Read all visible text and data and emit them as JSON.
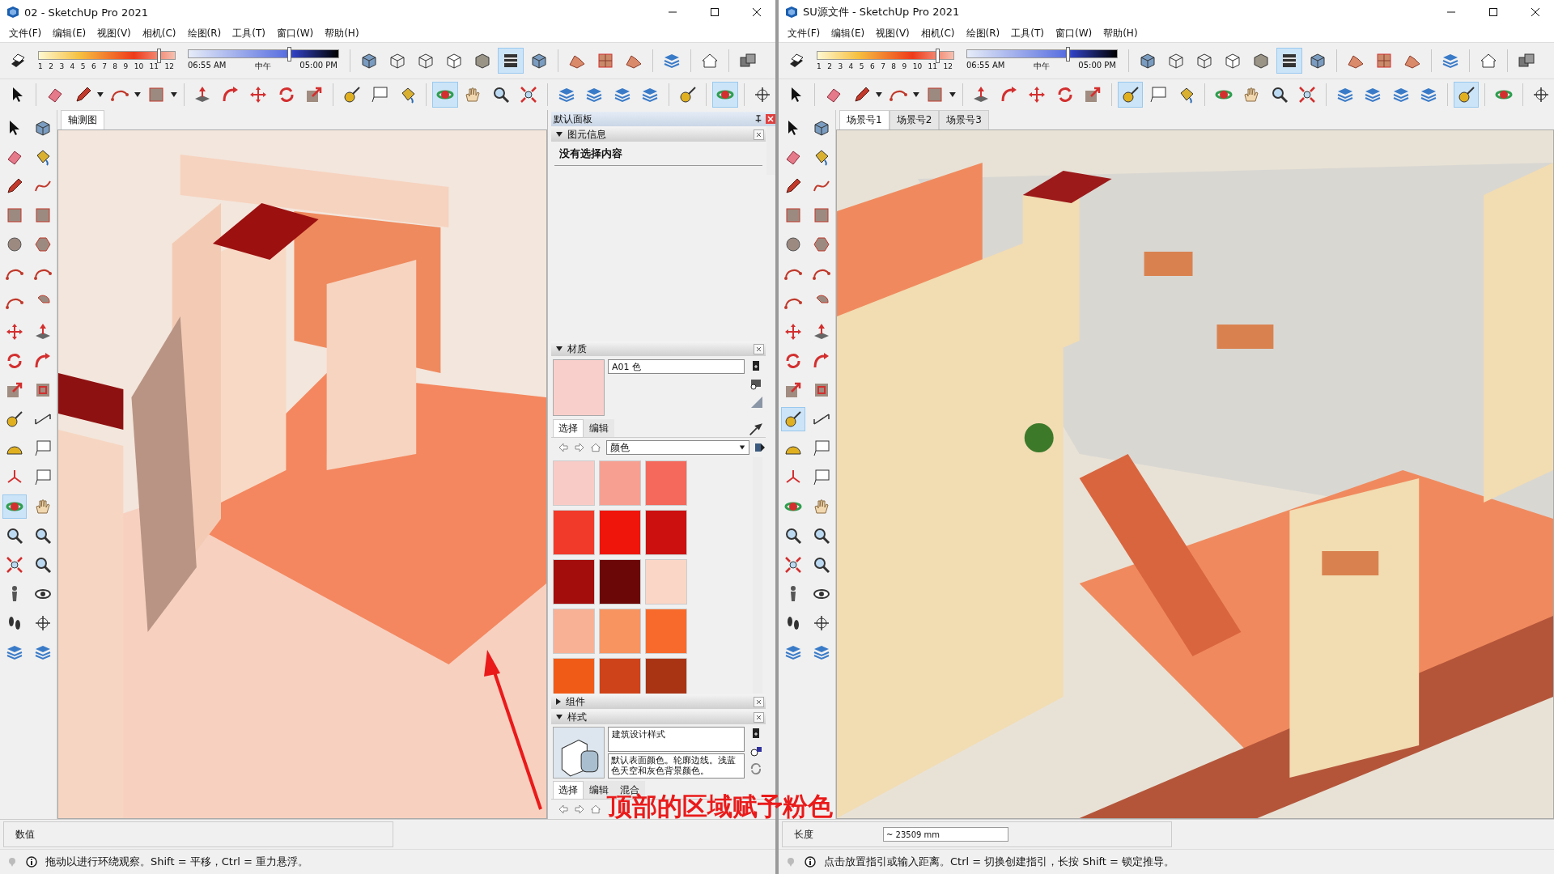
{
  "windows": [
    {
      "title": "02 - SketchUp Pro 2021",
      "menu": [
        "文件(F)",
        "编辑(E)",
        "视图(V)",
        "相机(C)",
        "绘图(R)",
        "工具(T)",
        "窗口(W)",
        "帮助(H)"
      ],
      "shadow_months": {
        "labels": [
          "1",
          "2",
          "3",
          "4",
          "5",
          "6",
          "7",
          "8",
          "9",
          "10",
          "11",
          "12"
        ],
        "level": 0.88
      },
      "shadow_time": {
        "start": "06:55 AM",
        "middle": "中午",
        "end": "05:00 PM",
        "level": 0.67
      },
      "toolbar_1": [
        {
          "selected": false
        },
        {
          "selected": false
        },
        {
          "selected": false
        },
        {
          "selected": false
        },
        {
          "selected": false
        },
        {
          "selected": false
        },
        {
          "selected": true
        },
        {
          "selected": false
        },
        {
          "selected": false
        },
        {
          "selected": false
        },
        {
          "selected": false
        },
        {
          "selected": false
        },
        {
          "selected": false
        },
        {
          "selected": false
        }
      ],
      "toolbar_2": [
        {
          "selected": false
        },
        {
          "selected": false
        },
        {
          "selected": false
        },
        {
          "selected": false
        },
        {
          "selected": false
        },
        {
          "selected": false
        },
        {
          "selected": false
        },
        {
          "selected": false
        },
        {
          "selected": false
        },
        {
          "selected": false
        },
        {
          "selected": false
        },
        {
          "selected": false
        },
        {
          "selected": false
        },
        {
          "selected": true
        },
        {
          "selected": false
        },
        {
          "selected": false
        },
        {
          "selected": false
        },
        {
          "selected": false
        },
        {
          "selected": false
        },
        {
          "selected": false
        },
        {
          "selected": false
        },
        {
          "selected": false
        },
        {
          "selected": true
        },
        {
          "selected": false
        }
      ],
      "palette": [
        {
          "selected": false
        },
        {
          "selected": false
        },
        {
          "selected": false
        },
        {
          "selected": false
        },
        {
          "selected": false
        },
        {
          "selected": false
        },
        {
          "selected": false
        },
        {
          "selected": false
        },
        {
          "selected": false
        },
        {
          "selected": false
        },
        {
          "selected": false
        },
        {
          "selected": false
        },
        {
          "selected": false
        },
        {
          "selected": false
        },
        {
          "selected": false
        },
        {
          "selected": false
        },
        {
          "selected": false
        },
        {
          "selected": false
        },
        {
          "selected": false
        },
        {
          "selected": false
        },
        {
          "selected": false
        },
        {
          "selected": false
        },
        {
          "selected": false
        },
        {
          "selected": false
        },
        {
          "selected": false
        },
        {
          "selected": false
        },
        {
          "selected": true
        },
        {
          "selected": false
        },
        {
          "selected": false
        },
        {
          "selected": false
        },
        {
          "selected": false
        },
        {
          "selected": false
        },
        {
          "selected": false
        },
        {
          "selected": false
        },
        {
          "selected": false
        },
        {
          "selected": false
        },
        {
          "selected": false
        },
        {
          "selected": false
        }
      ],
      "scene_tabs": [
        {
          "label": "轴测图",
          "selected": true
        }
      ],
      "viewport": {
        "kind": "picture"
      },
      "tray": {
        "title": "默认面板",
        "sections": [
          {
            "kind": "entity_info",
            "title": "图元信息",
            "expanded": true,
            "message": "没有选择内容"
          },
          {
            "kind": "materials",
            "title": "材质",
            "expanded": true,
            "material_name": "A01 色",
            "color": "#f9cfcb",
            "tabs": [
              {
                "label": "选择",
                "selected": true
              },
              {
                "label": "编辑",
                "selected": false
              }
            ],
            "library": "颜色",
            "colors": [
              {
                "color": "#f9cbc6"
              },
              {
                "color": "#f7a091"
              },
              {
                "color": "#f4695b"
              },
              {
                "color": "#f23a2b"
              },
              {
                "color": "#f0150a"
              },
              {
                "color": "#cc1010"
              },
              {
                "color": "#a30d0b"
              },
              {
                "color": "#6b0706"
              },
              {
                "color": "#fad6c6"
              },
              {
                "color": "#f9b196"
              },
              {
                "color": "#f89460"
              },
              {
                "color": "#f86a2b"
              },
              {
                "color": "#f05c18"
              },
              {
                "color": "#cf431a"
              },
              {
                "color": "#a83414"
              }
            ]
          },
          {
            "title": "组件",
            "expanded": false
          },
          {
            "kind": "styles",
            "title": "样式",
            "expanded": true,
            "style_name": "建筑设计样式",
            "description": "默认表面颜色。轮廓边线。浅蓝色天空和灰色背景颜色。",
            "tabs": [
              {
                "label": "选择",
                "selected": true
              },
              {
                "label": "编辑",
                "selected": false
              },
              {
                "label": "混合",
                "selected": false
              }
            ]
          }
        ]
      },
      "measurements": {
        "label": "数值"
      },
      "status_text": "拖动以进行环绕观察。Shift = 平移，Ctrl = 重力悬浮。"
    },
    {
      "title": "SU源文件 - SketchUp Pro 2021",
      "menu": [
        "文件(F)",
        "编辑(E)",
        "视图(V)",
        "相机(C)",
        "绘图(R)",
        "工具(T)",
        "窗口(W)",
        "帮助(H)"
      ],
      "shadow_months": {
        "labels": [
          "1",
          "2",
          "3",
          "4",
          "5",
          "6",
          "7",
          "8",
          "9",
          "10",
          "11",
          "12"
        ],
        "level": 0.88
      },
      "shadow_time": {
        "start": "06:55 AM",
        "middle": "中午",
        "end": "05:00 PM",
        "level": 0.67
      },
      "toolbar_1": [
        {
          "selected": false
        },
        {
          "selected": false
        },
        {
          "selected": false
        },
        {
          "selected": false
        },
        {
          "selected": false
        },
        {
          "selected": false
        },
        {
          "selected": true
        },
        {
          "selected": false
        },
        {
          "selected": false
        },
        {
          "selected": false
        },
        {
          "selected": false
        },
        {
          "selected": false
        },
        {
          "selected": false
        },
        {
          "selected": false
        }
      ],
      "toolbar_2": [
        {
          "selected": false
        },
        {
          "selected": false
        },
        {
          "selected": false
        },
        {
          "selected": false
        },
        {
          "selected": false
        },
        {
          "selected": false
        },
        {
          "selected": false
        },
        {
          "selected": false
        },
        {
          "selected": false
        },
        {
          "selected": false
        },
        {
          "selected": true
        },
        {
          "selected": false
        },
        {
          "selected": false
        },
        {
          "selected": false
        },
        {
          "selected": false
        },
        {
          "selected": false
        },
        {
          "selected": false
        },
        {
          "selected": false
        },
        {
          "selected": false
        },
        {
          "selected": false
        },
        {
          "selected": false
        },
        {
          "selected": true
        },
        {
          "selected": false
        },
        {
          "selected": false
        }
      ],
      "palette": [
        {
          "selected": false
        },
        {
          "selected": false
        },
        {
          "selected": false
        },
        {
          "selected": false
        },
        {
          "selected": false
        },
        {
          "selected": false
        },
        {
          "selected": false
        },
        {
          "selected": false
        },
        {
          "selected": false
        },
        {
          "selected": false
        },
        {
          "selected": false
        },
        {
          "selected": false
        },
        {
          "selected": false
        },
        {
          "selected": false
        },
        {
          "selected": false
        },
        {
          "selected": false
        },
        {
          "selected": false
        },
        {
          "selected": false
        },
        {
          "selected": false
        },
        {
          "selected": false
        },
        {
          "selected": true
        },
        {
          "selected": false
        },
        {
          "selected": false
        },
        {
          "selected": false
        },
        {
          "selected": false
        },
        {
          "selected": false
        },
        {
          "selected": false
        },
        {
          "selected": false
        },
        {
          "selected": false
        },
        {
          "selected": false
        },
        {
          "selected": false
        },
        {
          "selected": false
        },
        {
          "selected": false
        },
        {
          "selected": false
        },
        {
          "selected": false
        },
        {
          "selected": false
        },
        {
          "selected": false
        },
        {
          "selected": false
        }
      ],
      "scene_tabs": [
        {
          "label": "场景号1",
          "selected": true
        },
        {
          "label": "场景号2",
          "selected": false
        },
        {
          "label": "场景号3",
          "selected": false
        }
      ],
      "viewport": {
        "kind": "picture"
      },
      "measurements": {
        "label": "长度",
        "value": "~ 23509 mm"
      },
      "status_text": "点击放置指引或输入距离。Ctrl = 切换创建指引，长按 Shift = 锁定推导。"
    }
  ],
  "annotation": {
    "text": "顶部的区域赋予粉色"
  }
}
